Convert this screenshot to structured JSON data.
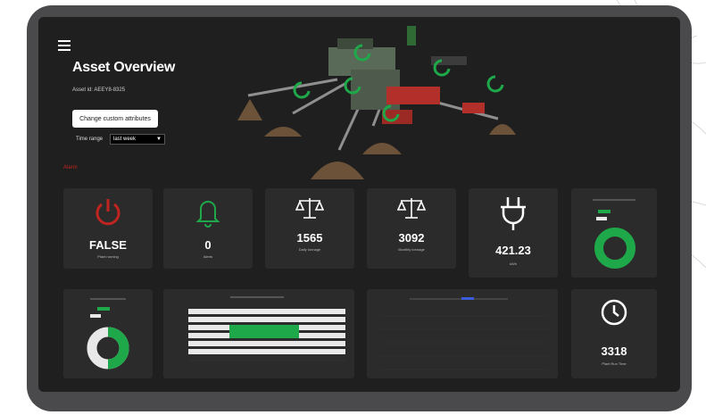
{
  "header": {
    "title": "Asset Overview",
    "asset_id": "Asset id: AEEY8-8325",
    "attributes_button": "Change custom attributes",
    "time_range_label": "Time range",
    "time_range_value": "last week",
    "alert_text": "Alarm"
  },
  "cards": {
    "plant_running": {
      "value": "FALSE",
      "label": "Plant running"
    },
    "alerts": {
      "value": "0",
      "label": "Alerts"
    },
    "daily_tonnage": {
      "value": "1565",
      "label": "Daily tonnage"
    },
    "monthly_tonnage": {
      "value": "3092",
      "label": "Monthly tonnage"
    },
    "power": {
      "value": "421.23",
      "label": "kWh"
    },
    "run_time": {
      "value": "3318",
      "label": "Plant Run Time"
    }
  },
  "colors": {
    "accent_green": "#1fa84a",
    "alarm_red": "#c0241f",
    "card_bg": "#2b2b2b",
    "screen_bg": "#1f1f1f"
  },
  "icons": [
    "power-icon",
    "bell-icon",
    "scale-icon",
    "plug-icon",
    "clock-icon",
    "refresh-icon",
    "menu-icon"
  ]
}
